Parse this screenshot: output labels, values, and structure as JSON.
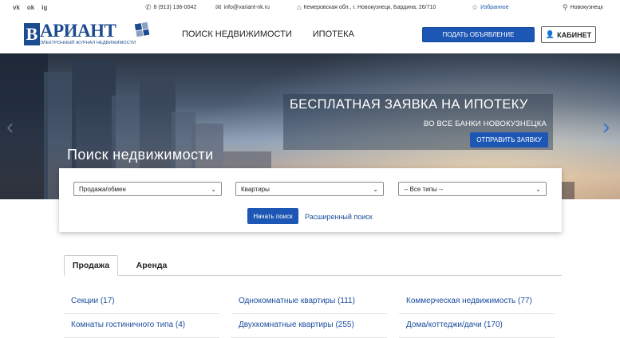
{
  "topbar": {
    "social": [
      "vk",
      "ok",
      "ig"
    ],
    "phone": "8 (913) 136-0042",
    "email": "info@variant-nk.ru",
    "address": "Кемеровская обл., г. Новокузнецк, Бардина, 26/710",
    "favorites": "Избранное",
    "city": "Новокузнецк"
  },
  "header": {
    "logo_letter": "В",
    "logo_word": "АРИАНТ",
    "logo_sub": "ЭЛЕКТРОННЫЙ ЖУРНАЛ НЕДВИЖИМОСТИ",
    "nav": [
      "ПОИСК НЕДВИЖИМОСТИ",
      "ИПОТЕКА"
    ],
    "post_button": "ПОДАТЬ ОБЪЯВЛЕНИЕ",
    "cabinet_button": "КАБИНЕТ"
  },
  "hero": {
    "promo_title": "БЕСПЛАТНАЯ ЗАЯВКА НА ИПОТЕКУ",
    "promo_sub": "ВО ВСЕ БАНКИ НОВОКУЗНЕЦКА",
    "promo_button": "ОТПРАВИТЬ ЗАЯВКУ",
    "search_title": "Поиск недвижимости",
    "prev_arrow": "‹",
    "next_arrow": "›"
  },
  "search": {
    "deal": "Продажа/обмен",
    "property": "Квартиры",
    "type": "-- Все типы --",
    "submit": "Начать поиск",
    "advanced": "Расширенный поиск"
  },
  "tabs": [
    "Продажа",
    "Аренда"
  ],
  "categories": [
    [
      "Секции (17)",
      "Однокомнатные квартиры (111)",
      "Коммерческая недвижимость (77)"
    ],
    [
      "Комнаты гостиничного типа (4)",
      "Двухкомнатные квартиры (255)",
      "Дома/коттеджи/дачи (170)"
    ]
  ],
  "colors": {
    "brand": "#1d4b8f",
    "button": "#1d57b5",
    "link": "#1b4e9e"
  }
}
